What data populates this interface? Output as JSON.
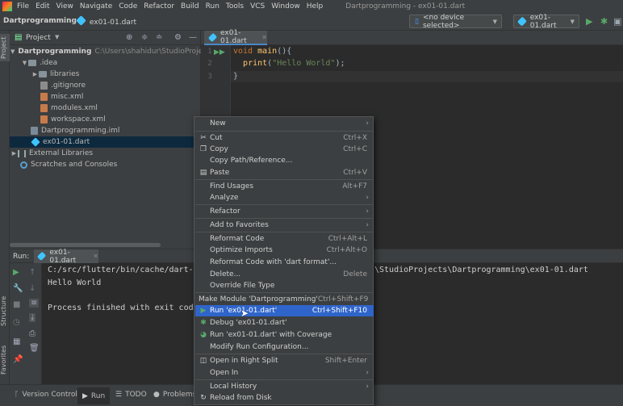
{
  "menubar": {
    "items": [
      "File",
      "Edit",
      "View",
      "Navigate",
      "Code",
      "Refactor",
      "Build",
      "Run",
      "Tools",
      "VCS",
      "Window",
      "Help"
    ],
    "window_title": "Dartprogramming - ex01-01.dart"
  },
  "navbar": {
    "project": "Dartprogramming",
    "file": "ex01-01.dart",
    "device_selector": "<no device selected>",
    "run_config": "ex01-01.dart"
  },
  "left_strip": {
    "project_label": "Project",
    "structure_label": "Structure",
    "favorites_label": "Favorites"
  },
  "project_panel": {
    "title": "Project",
    "tree": [
      {
        "label": "Dartprogramming",
        "path": "C:\\Users\\shahidur\\StudioProjects\\Da"
      },
      {
        "label": ".idea"
      },
      {
        "label": "libraries"
      },
      {
        "label": ".gitignore"
      },
      {
        "label": "misc.xml"
      },
      {
        "label": "modules.xml"
      },
      {
        "label": "workspace.xml"
      },
      {
        "label": "Dartprogramming.iml"
      },
      {
        "label": "ex01-01.dart"
      },
      {
        "label": "External Libraries"
      },
      {
        "label": "Scratches and Consoles"
      }
    ]
  },
  "editor": {
    "tab": "ex01-01.dart",
    "line_numbers": [
      "1",
      "2",
      "3"
    ],
    "code": {
      "l1_kw": "void",
      "l1_fn": "main",
      "l1_rest": "(){",
      "l2_fn": "print",
      "l2_open": "(",
      "l2_str": "\"Hello World\"",
      "l2_close": ");",
      "l3": "}"
    }
  },
  "run_panel": {
    "label": "Run:",
    "tab": "ex01-01.dart",
    "console": [
      "C:/src/flutter/bin/cache/dart-sd",
      "Hello World",
      "",
      "Process finished with exit code"
    ],
    "console_right": "\\StudioProjects\\Dartprogramming\\ex01-01.dart"
  },
  "status_bar": {
    "items": [
      "Version Control",
      "Run",
      "TODO",
      "Problems"
    ]
  },
  "context_menu": {
    "items": [
      {
        "label": "New",
        "shortcut": "",
        "submenu": true
      },
      {
        "label": "Cut",
        "shortcut": "Ctrl+X",
        "icon": "cut-icon"
      },
      {
        "label": "Copy",
        "shortcut": "Ctrl+C",
        "icon": "copy-icon"
      },
      {
        "label": "Copy Path/Reference...",
        "shortcut": ""
      },
      {
        "label": "Paste",
        "shortcut": "Ctrl+V",
        "icon": "paste-icon"
      },
      {
        "label": "Find Usages",
        "shortcut": "Alt+F7"
      },
      {
        "label": "Analyze",
        "shortcut": "",
        "submenu": true
      },
      {
        "label": "Refactor",
        "shortcut": "",
        "submenu": true
      },
      {
        "label": "Add to Favorites",
        "shortcut": "",
        "submenu": true
      },
      {
        "label": "Reformat Code",
        "shortcut": "Ctrl+Alt+L"
      },
      {
        "label": "Optimize Imports",
        "shortcut": "Ctrl+Alt+O"
      },
      {
        "label": "Reformat Code with 'dart format'...",
        "shortcut": ""
      },
      {
        "label": "Delete...",
        "shortcut": "Delete"
      },
      {
        "label": "Override File Type",
        "shortcut": ""
      },
      {
        "label": "Make Module 'Dartprogramming'",
        "shortcut": "Ctrl+Shift+F9"
      },
      {
        "label": "Run 'ex01-01.dart'",
        "shortcut": "Ctrl+Shift+F10",
        "icon": "run-icon"
      },
      {
        "label": "Debug 'ex01-01.dart'",
        "shortcut": "",
        "icon": "debug-icon"
      },
      {
        "label": "Run 'ex01-01.dart' with Coverage",
        "shortcut": "",
        "icon": "coverage-icon"
      },
      {
        "label": "Modify Run Configuration...",
        "shortcut": ""
      },
      {
        "label": "Open in Right Split",
        "shortcut": "Shift+Enter",
        "icon": "split-icon"
      },
      {
        "label": "Open In",
        "shortcut": "",
        "submenu": true
      },
      {
        "label": "Local History",
        "shortcut": "",
        "submenu": true
      },
      {
        "label": "Reload from Disk",
        "shortcut": "",
        "icon": "reload-icon"
      }
    ],
    "highlighted_index": 15
  },
  "colors": {
    "accent": "#2f65ca",
    "run_green": "#59a869",
    "dart_blue": "#40c4ff"
  }
}
